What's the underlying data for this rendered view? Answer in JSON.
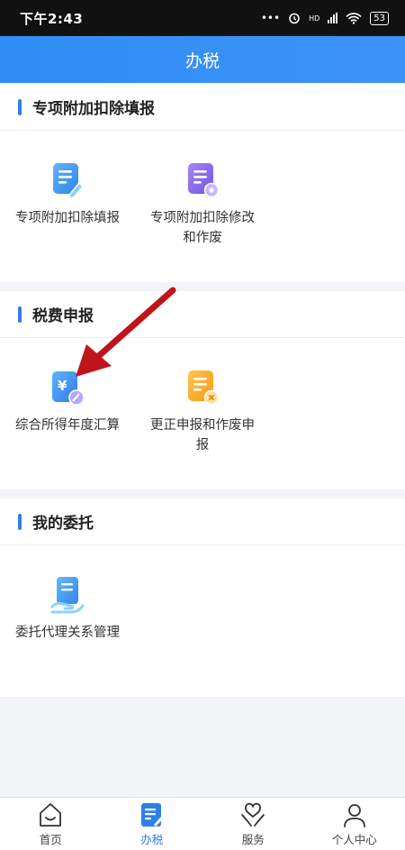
{
  "status": {
    "time": "下午2:43",
    "dots": "•••",
    "network": "HD",
    "battery": "53"
  },
  "nav": {
    "title": "办税"
  },
  "sections": [
    {
      "title": "专项附加扣除填报",
      "tiles": [
        {
          "label": "专项附加扣除填报",
          "icon": "doc-edit-icon"
        },
        {
          "label": "专项附加扣除修改和作废",
          "icon": "doc-gear-icon"
        }
      ]
    },
    {
      "title": "税费申报",
      "tiles": [
        {
          "label": "综合所得年度汇算",
          "icon": "yuan-doc-icon"
        },
        {
          "label": "更正申报和作废申报",
          "icon": "doc-cancel-icon"
        }
      ]
    },
    {
      "title": "我的委托",
      "tiles": [
        {
          "label": "委托代理关系管理",
          "icon": "doc-hand-icon"
        }
      ]
    }
  ],
  "tabs": [
    {
      "label": "首页",
      "icon": "home-icon",
      "active": false
    },
    {
      "label": "办税",
      "icon": "tax-doc-icon",
      "active": true
    },
    {
      "label": "服务",
      "icon": "heart-hand-icon",
      "active": false
    },
    {
      "label": "个人中心",
      "icon": "person-icon",
      "active": false
    }
  ],
  "colors": {
    "brand": "#2f8df5",
    "accent": "#2f7fe8",
    "annotation": "#c0141b"
  }
}
